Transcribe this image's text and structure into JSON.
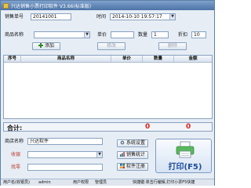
{
  "window": {
    "title": "兴达销售小票打印软件 V3.66(标准版)"
  },
  "header": {
    "receipt_no_label": "销售单号",
    "receipt_no_value": "20141001",
    "time_label": "时间",
    "time_value": "2014-10-10 19:57:17"
  },
  "entry": {
    "product_label": "商品名称",
    "price_label": "单价",
    "qty_label": "数量",
    "qty_value": "1",
    "discount_label": "折扣",
    "discount_value": "10",
    "add_button": "添加",
    "modify_button": "修改",
    "delete_button": "删除"
  },
  "table": {
    "columns": [
      "序号",
      "商品名称",
      "单价",
      "数量",
      "金额"
    ],
    "rows": []
  },
  "totals": {
    "label": "合计:",
    "quantity": "0",
    "amount": "0"
  },
  "footer": {
    "shop_label": "商店名称",
    "shop_value": "兴达软件",
    "cashier_label": "收银",
    "salesperson_label": "找零",
    "btn_system": "系统设置",
    "btn_stats": "销售统计",
    "btn_register": "软件注册",
    "print_button": "打印(F5)"
  },
  "status": {
    "user_label": "用户名(收银员)",
    "user_value": "admin",
    "perm_label": "用户权限",
    "perm_value": "管理员",
    "hint": "快捷键:单击行编辑,打印小票F5快捷"
  },
  "colors": {
    "accent": "#1d4d9a",
    "total": "#e0201a",
    "title_bar": "#5a80b3"
  }
}
